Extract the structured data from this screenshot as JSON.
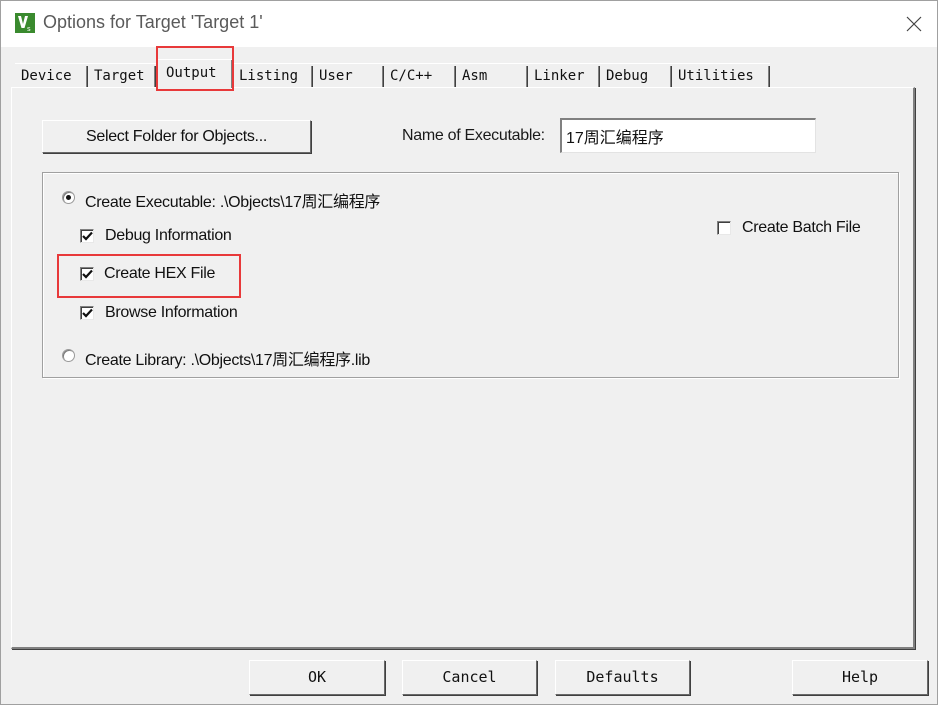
{
  "window": {
    "title": "Options for Target 'Target 1'",
    "icon": "keil-uvision-icon",
    "close_icon": "close-icon"
  },
  "tabs": [
    {
      "label": "Device",
      "active": false
    },
    {
      "label": "Target",
      "active": false
    },
    {
      "label": "Output",
      "active": true
    },
    {
      "label": "Listing",
      "active": false
    },
    {
      "label": "User",
      "active": false
    },
    {
      "label": "C/C++",
      "active": false
    },
    {
      "label": "Asm",
      "active": false
    },
    {
      "label": "Linker",
      "active": false
    },
    {
      "label": "Debug",
      "active": false
    },
    {
      "label": "Utilities",
      "active": false
    }
  ],
  "output": {
    "select_folder_label": "Select Folder for Objects...",
    "name_of_executable_label": "Name of Executable:",
    "name_of_executable_value": "17周汇编程序",
    "create_executable": {
      "label": "Create Executable:  .\\Objects\\17周汇编程序",
      "selected": true
    },
    "debug_information": {
      "label": "Debug Information",
      "checked": true
    },
    "create_hex_file": {
      "label": "Create HEX File",
      "checked": true
    },
    "browse_information": {
      "label": "Browse Information",
      "checked": true
    },
    "create_library": {
      "label": "Create Library:  .\\Objects\\17周汇编程序.lib",
      "selected": false
    },
    "create_batch_file": {
      "label": "Create Batch File",
      "checked": false
    }
  },
  "buttons": {
    "ok": "OK",
    "cancel": "Cancel",
    "defaults": "Defaults",
    "help": "Help"
  },
  "annotations": {
    "highlight_color": "#e8393a"
  }
}
